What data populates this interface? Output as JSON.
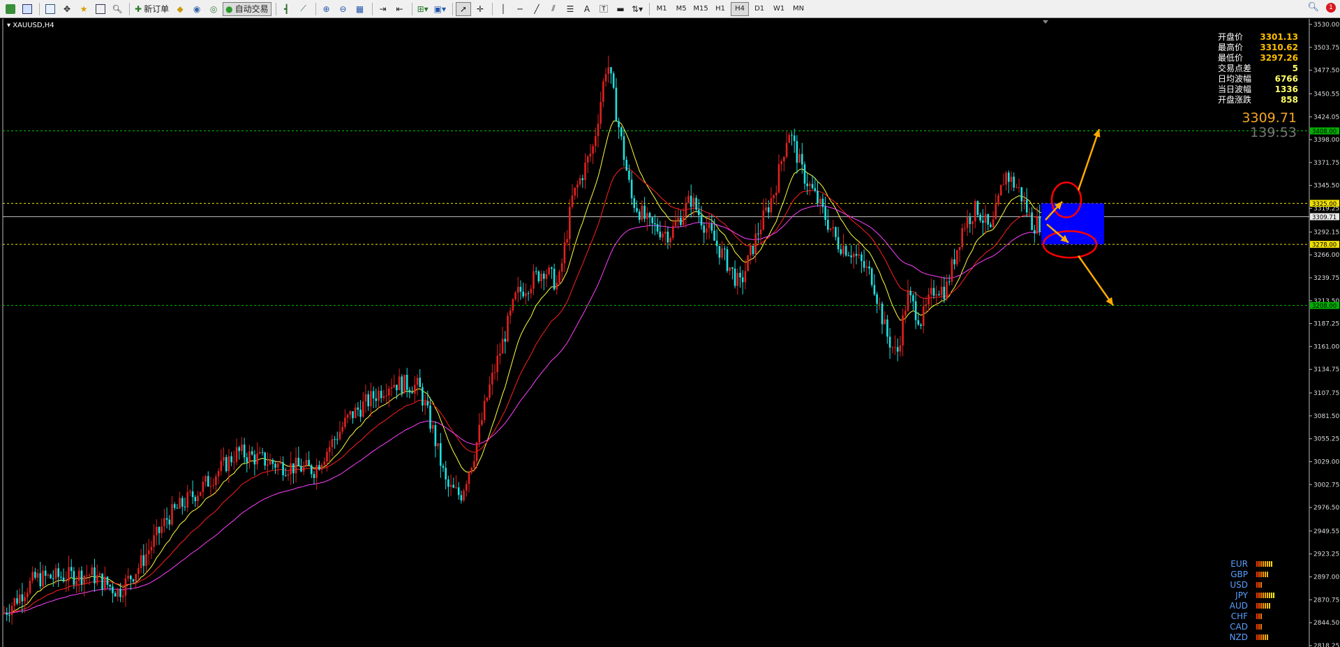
{
  "toolbar": {
    "new_order_label": "新订单",
    "auto_trade_label": "自动交易",
    "timeframes": [
      "M1",
      "M5",
      "M15",
      "H1",
      "H4",
      "D1",
      "W1",
      "MN"
    ],
    "active_timeframe": "H4",
    "notification_count": "1",
    "icons": [
      "new-chart-icon",
      "profiles-icon",
      "market-watch-icon",
      "navigator-icon",
      "favorites-icon",
      "terminal-icon",
      "tester-icon",
      "new-order-icon",
      "gold-icon",
      "signals-icon",
      "market-icon",
      "auto-trade-icon",
      "bar-chart-icon",
      "candle-chart-icon",
      "zoom-in-icon",
      "zoom-out-icon",
      "tile-icon",
      "autoscroll-icon",
      "chart-shift-icon",
      "indicators-icon",
      "templates-icon",
      "cursor-icon",
      "crosshair-icon",
      "vertical-line-icon",
      "horizontal-line-icon",
      "trendline-icon",
      "equidistant-channel-icon",
      "fibonacci-icon",
      "text-icon",
      "text-label-icon",
      "rectangle-icon",
      "arrows-icon",
      "search-icon"
    ]
  },
  "chart": {
    "symbol_label": "XAUUSD,H4",
    "info_panel": [
      {
        "label": "开盘价",
        "value": "3301.13"
      },
      {
        "label": "最高价",
        "value": "3310.62"
      },
      {
        "label": "最低价",
        "value": "3297.26"
      },
      {
        "label": "交易点差",
        "value": "5"
      },
      {
        "label": "日均波幅",
        "value": "6766"
      },
      {
        "label": "当日波幅",
        "value": "1336"
      },
      {
        "label": "开盘涨跌",
        "value": "858"
      }
    ],
    "current_price": "3309.71",
    "countdown": "139:53",
    "price_axis": [
      "3530.00",
      "3503.75",
      "3477.50",
      "3450.55",
      "3424.05",
      "3398.00",
      "3371.75",
      "3345.50",
      "3319.25",
      "3292.15",
      "3266.00",
      "3239.75",
      "3213.50",
      "3187.25",
      "3161.00",
      "3134.75",
      "3107.75",
      "3081.50",
      "3055.25",
      "3029.00",
      "3002.75",
      "2976.50",
      "2949.55",
      "2923.25",
      "2897.00",
      "2870.75",
      "2844.50",
      "2818.25"
    ],
    "level_tags": [
      {
        "label": "3408.00",
        "price": 3408,
        "color": "#00b000",
        "line": "#00c000"
      },
      {
        "label": "3325.00",
        "price": 3325,
        "color": "#f0e000",
        "line": "#f0e000"
      },
      {
        "label": "3309.71",
        "price": 3309.71,
        "color": "#e8e8e8",
        "line": "#bbbbbb"
      },
      {
        "label": "3278.00",
        "price": 3278,
        "color": "#f0e000",
        "line": "#f0e000"
      },
      {
        "label": "3208.00",
        "price": 3208,
        "color": "#00b000",
        "line": "#00c000"
      }
    ],
    "colors": {
      "bull": "#e02020",
      "bear": "#20e0e0",
      "ma_fast": "#ffff40",
      "ma_mid": "#ff2020",
      "ma_slow": "#ff40ff",
      "zone": "#0000ff",
      "arrow": "#ffaa00",
      "circle": "#ff0000"
    }
  },
  "currency_strength": [
    {
      "name": "EUR",
      "level": 8
    },
    {
      "name": "GBP",
      "level": 6
    },
    {
      "name": "USD",
      "level": 3
    },
    {
      "name": "JPY",
      "level": 9
    },
    {
      "name": "AUD",
      "level": 7
    },
    {
      "name": "CHF",
      "level": 3
    },
    {
      "name": "CAD",
      "level": 3
    },
    {
      "name": "NZD",
      "level": 6
    }
  ]
}
